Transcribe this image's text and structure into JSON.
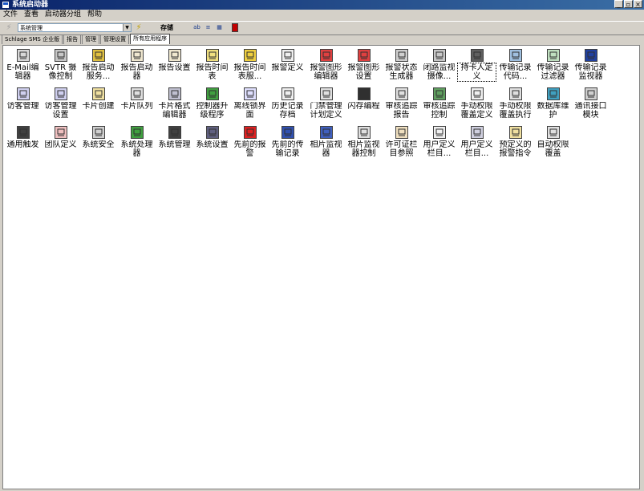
{
  "window": {
    "title": "系统启动器",
    "min": "_",
    "max": "▫",
    "close": "×"
  },
  "menu": [
    "文件",
    "查看",
    "启动器分组",
    "帮助"
  ],
  "toolbar": {
    "combo_value": "系统管理",
    "label": "存储",
    "btn1": "ab",
    "btn2": "≡",
    "btn3": "▦"
  },
  "tabs": [
    "Schlage SMS 企业版",
    "报告",
    "管理",
    "管理设置",
    "所有应用程序"
  ],
  "active_tab": 4,
  "items": [
    {
      "label": "E-Mail编辑器",
      "icon": "email-editor-icon",
      "color": "#d8d8d8"
    },
    {
      "label": "SVTR 摄像控制",
      "icon": "camera-icon",
      "color": "#c8c8c8"
    },
    {
      "label": "报告启动服务...",
      "icon": "report-service-icon",
      "color": "#e0c040"
    },
    {
      "label": "报告启动器",
      "icon": "report-launcher-icon",
      "color": "#f0e8d0"
    },
    {
      "label": "报告设置",
      "icon": "report-settings-icon",
      "color": "#f0e8d0"
    },
    {
      "label": "报告时间表",
      "icon": "report-schedule-icon",
      "color": "#f0e080"
    },
    {
      "label": "报告时间表服...",
      "icon": "report-schedule-service-icon",
      "color": "#f0d040"
    },
    {
      "label": "报警定义",
      "icon": "alarm-definition-icon",
      "color": "#f0f0f0"
    },
    {
      "label": "报警图形编辑器",
      "icon": "alarm-graphic-editor-icon",
      "color": "#e04040"
    },
    {
      "label": "报警图形设置",
      "icon": "alarm-graphic-settings-icon",
      "color": "#e04040"
    },
    {
      "label": "报警状态生成器",
      "icon": "alarm-state-generator-icon",
      "color": "#d0d0d0"
    },
    {
      "label": "闭路监视摄像...",
      "icon": "cctv-camera-icon",
      "color": "#c8c8c8"
    },
    {
      "label": "持卡人定义",
      "icon": "cardholder-definition-icon",
      "color": "#606060"
    },
    {
      "label": "传输记录代码...",
      "icon": "transmission-code-icon",
      "color": "#a0c0e0"
    },
    {
      "label": "传输记录过滤器",
      "icon": "transmission-filter-icon",
      "color": "#c0e0c0"
    },
    {
      "label": "传输记录监视器",
      "icon": "transmission-monitor-icon",
      "color": "#2040a0"
    },
    {
      "label": "访客管理",
      "icon": "visitor-management-icon",
      "color": "#d0d0f0"
    },
    {
      "label": "访客管理设置",
      "icon": "visitor-settings-icon",
      "color": "#d0d0f0"
    },
    {
      "label": "卡片创建",
      "icon": "card-create-icon",
      "color": "#f0e0a0"
    },
    {
      "label": "卡片队列",
      "icon": "card-queue-icon",
      "color": "#e0e0e0"
    },
    {
      "label": "卡片格式编辑器",
      "icon": "card-format-editor-icon",
      "color": "#c0c0d0"
    },
    {
      "label": "控制器升级程序",
      "icon": "controller-upgrade-icon",
      "color": "#40a040"
    },
    {
      "label": "离线锁界面",
      "icon": "offline-lock-icon",
      "color": "#e0e0ff"
    },
    {
      "label": "历史记录存档",
      "icon": "history-archive-icon",
      "color": "#f0f0f0"
    },
    {
      "label": "门禁管理计划定义",
      "icon": "access-schedule-icon",
      "color": "#e0e0e0"
    },
    {
      "label": "闪存编程",
      "icon": "flash-program-icon",
      "color": "#303030"
    },
    {
      "label": "审核追踪报告",
      "icon": "audit-report-icon",
      "color": "#e0e0e0"
    },
    {
      "label": "审核追踪控制",
      "icon": "audit-control-icon",
      "color": "#60a060"
    },
    {
      "label": "手动权限覆盖定义",
      "icon": "manual-override-definition-icon",
      "color": "#f0f0f0"
    },
    {
      "label": "手动权限覆盖执行",
      "icon": "manual-override-execute-icon",
      "color": "#e0e0e0"
    },
    {
      "label": "数据库维护",
      "icon": "database-maintenance-icon",
      "color": "#40a0c0"
    },
    {
      "label": "通讯接口模块",
      "icon": "comm-module-icon",
      "color": "#d0d0d0"
    },
    {
      "label": "通用触发",
      "icon": "trigger-icon",
      "color": "#404040"
    },
    {
      "label": "团队定义",
      "icon": "team-definition-icon",
      "color": "#f0c0c0"
    },
    {
      "label": "系统安全",
      "icon": "system-security-icon",
      "color": "#d0d0d0"
    },
    {
      "label": "系统处理器",
      "icon": "system-processor-icon",
      "color": "#40a040"
    },
    {
      "label": "系统管理",
      "icon": "system-management-icon",
      "color": "#404040"
    },
    {
      "label": "系统设置",
      "icon": "system-settings-icon",
      "color": "#606080"
    },
    {
      "label": "先前的报警",
      "icon": "previous-alarm-icon",
      "color": "#e02020"
    },
    {
      "label": "先前的传输记录",
      "icon": "previous-transmission-icon",
      "color": "#3050b0"
    },
    {
      "label": "相片监视器",
      "icon": "photo-monitor-icon",
      "color": "#4060c0"
    },
    {
      "label": "相片监视器控制",
      "icon": "photo-monitor-control-icon",
      "color": "#e0e0e0"
    },
    {
      "label": "许可证栏目参照",
      "icon": "license-column-icon",
      "color": "#f0e0c0"
    },
    {
      "label": "用户定义栏目...",
      "icon": "user-column-icon",
      "color": "#f0f0f0"
    },
    {
      "label": "用户定义栏目...",
      "icon": "user-column-2-icon",
      "color": "#d0d0e0"
    },
    {
      "label": "预定义的报警指令",
      "icon": "predefined-alarm-icon",
      "color": "#f0e0a0"
    },
    {
      "label": "自动权限覆盖",
      "icon": "auto-override-icon",
      "color": "#e0e0e0"
    }
  ],
  "selected_item": 12
}
